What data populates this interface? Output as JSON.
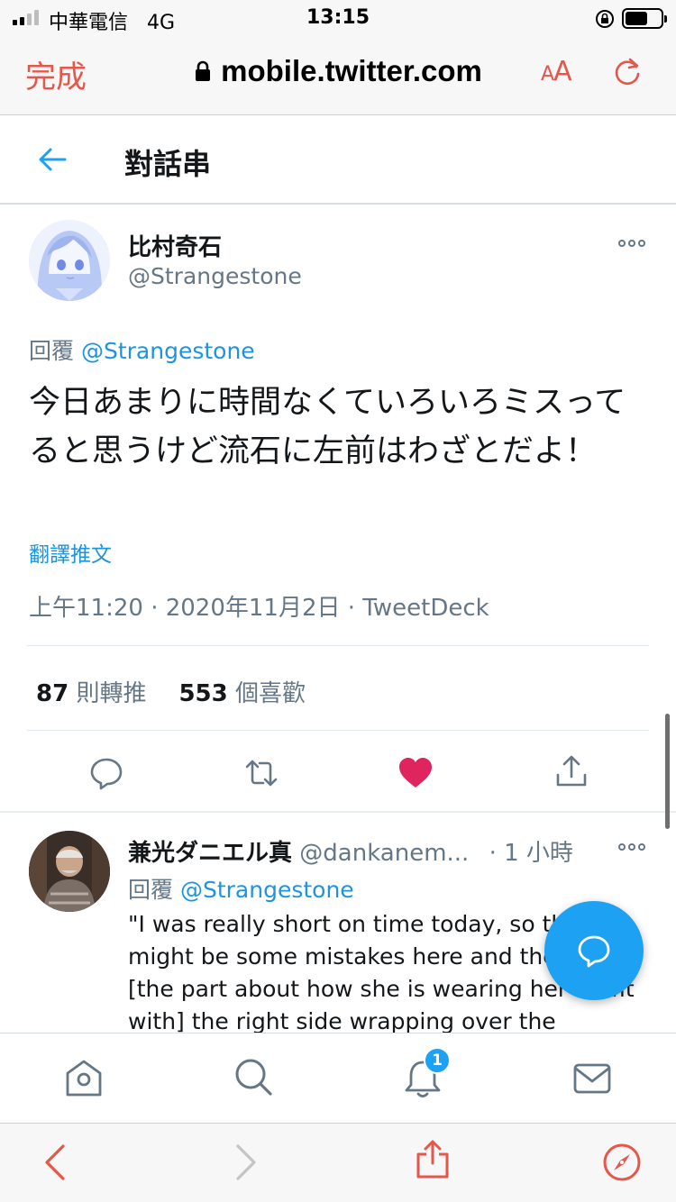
{
  "status_bar": {
    "carrier": "中華電信",
    "network": "4G",
    "time": "13:15"
  },
  "browser": {
    "done_label": "完成",
    "url": "mobile.twitter.com",
    "text_size_label_small": "A",
    "text_size_label_large": "A",
    "accent_color": "#e5574a"
  },
  "header": {
    "title": "對話串"
  },
  "main_tweet": {
    "display_name": "比村奇石",
    "handle": "@Strangestone",
    "reply_prefix": "回覆",
    "reply_to": "@Strangestone",
    "text": "今日あまりに時間なくていろいろミスってると思うけど流石に左前はわざとだよ！",
    "translate_label": "翻譯推文",
    "timestamp": "上午11:20 · 2020年11月2日 · TweetDeck",
    "retweet_count": "87",
    "retweet_label": "則轉推",
    "like_count": "553",
    "like_label": "個喜歡",
    "liked": true,
    "like_color": "#e0245e"
  },
  "reply_tweet": {
    "display_name": "兼光ダニエル真",
    "handle": "@dankanem...",
    "time_ago": "· 1 小時",
    "reply_prefix": "回覆",
    "reply_to": "@Strangestone",
    "text": "\"I was really short on time today, so there might be some mistakes here and there, but [the part about how she is wearing her outfit with] the right side wrapping over the"
  },
  "bottom_nav": {
    "items": [
      "home-icon",
      "search-icon",
      "notifications-icon",
      "messages-icon"
    ],
    "notification_badge": "1"
  },
  "safari_toolbar": {
    "items": [
      "back-icon",
      "forward-icon",
      "share-icon",
      "compass-icon"
    ]
  },
  "brand_color": "#1da1f2"
}
